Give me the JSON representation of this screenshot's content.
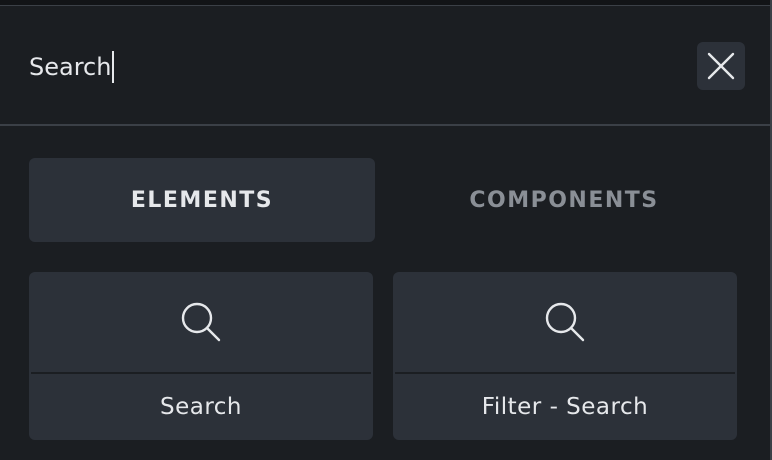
{
  "search": {
    "value": "Search",
    "close_icon": "close-icon"
  },
  "tabs": [
    {
      "label": "ELEMENTS",
      "active": true
    },
    {
      "label": "COMPONENTS",
      "active": false
    }
  ],
  "cards": [
    {
      "label": "Search",
      "icon": "search-icon"
    },
    {
      "label": "Filter - Search",
      "icon": "search-icon"
    }
  ],
  "colors": {
    "background": "#1b1e22",
    "surface": "#2c3139",
    "text": "#e6e8eb",
    "muted_text": "#8a8f96",
    "border": "#3b4047"
  }
}
